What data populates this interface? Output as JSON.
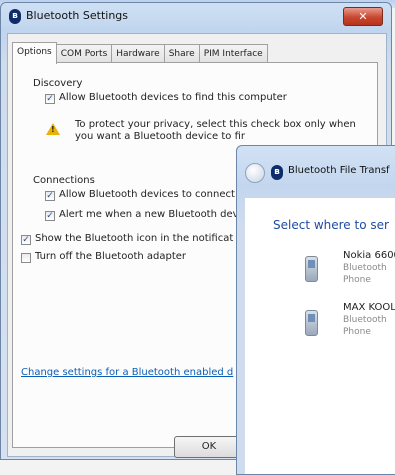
{
  "settings_window": {
    "title": "Bluetooth Settings",
    "tabs": [
      "Options",
      "COM Ports",
      "Hardware",
      "Share",
      "PIM Interface"
    ],
    "discovery": {
      "header": "Discovery",
      "allow_label": "Allow Bluetooth devices to find this computer",
      "allow_checked": true,
      "warning_line1": "To protect your privacy, select this check box only when",
      "warning_line2": "you want a Bluetooth device to fir"
    },
    "connections": {
      "header": "Connections",
      "allow_connect_label": "Allow Bluetooth devices to connect t",
      "allow_connect_checked": true,
      "alert_label": "Alert me when a new Bluetooth devi",
      "alert_checked": true
    },
    "show_icon_label": "Show the Bluetooth icon in the notificat",
    "show_icon_checked": true,
    "turn_off_label": "Turn off the Bluetooth adapter",
    "turn_off_checked": false,
    "change_link": "Change settings for a Bluetooth enabled d",
    "ok_label": "OK"
  },
  "transfer_window": {
    "title": "Bluetooth File Transf",
    "heading": "Select where to ser",
    "devices": [
      {
        "name": "Nokia 6600",
        "type_line1": "Bluetooth",
        "type_line2": "Phone"
      },
      {
        "name": "MAX KOOL",
        "type_line1": "Bluetooth",
        "type_line2": "Phone"
      }
    ]
  },
  "icons": {
    "bluetooth": "bluetooth-icon",
    "warning": "warning-icon",
    "phone": "phone-icon",
    "back": "back-arrow-icon",
    "close": "close-icon"
  },
  "colors": {
    "link": "#0b5eb8",
    "heading": "#1f4ca3",
    "close_button": "#c8472f",
    "warning": "#e7b30b"
  }
}
